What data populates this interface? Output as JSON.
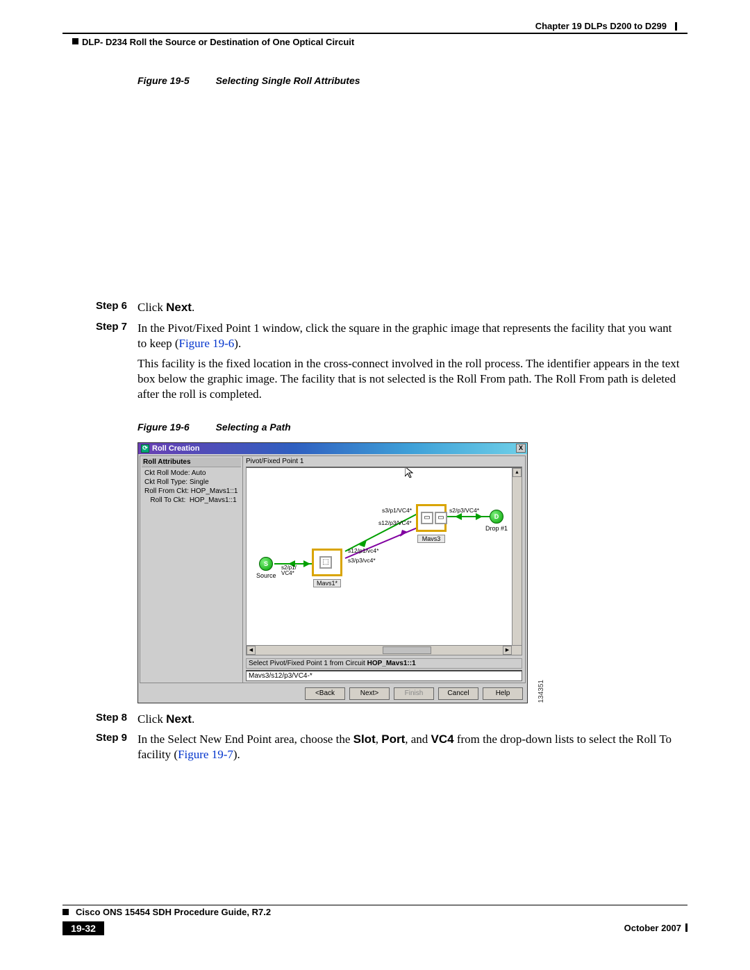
{
  "header": {
    "chapter": "Chapter 19  DLPs D200 to D299",
    "subtitle": "DLP- D234 Roll the Source or Destination of One Optical Circuit"
  },
  "fig5": {
    "num": "Figure 19-5",
    "caption": "Selecting Single Roll Attributes"
  },
  "steps": {
    "s6_label": "Step 6",
    "s6_a": "Click ",
    "s6_b": "Next",
    "s6_c": ".",
    "s7_label": "Step 7",
    "s7_a": "In the Pivot/Fixed Point 1 window, click the square in the graphic image that represents the facility that you want to keep (",
    "s7_link": "Figure 19-6",
    "s7_b": ").",
    "para1": "This facility is the fixed location in the cross-connect involved in the roll process. The identifier appears in the text box below the graphic image. The facility that is not selected is the Roll From path. The Roll From path is deleted after the roll is completed.",
    "s8_label": "Step 8",
    "s8_a": "Click ",
    "s8_b": "Next",
    "s8_c": ".",
    "s9_label": "Step 9",
    "s9_a": "In the Select New End Point area, choose the ",
    "s9_slot": "Slot",
    "s9_b": ", ",
    "s9_port": "Port",
    "s9_c": ", and ",
    "s9_vc4": "VC4",
    "s9_d": " from the drop-down lists to select the Roll To facility (",
    "s9_link": "Figure 19-7",
    "s9_e": ")."
  },
  "fig6": {
    "num": "Figure 19-6",
    "caption": "Selecting a Path",
    "id": "134351"
  },
  "rollwin": {
    "title": "Roll Creation",
    "close": "X",
    "left_title": "Roll Attributes",
    "attrs": {
      "a1": "Ckt Roll Mode: Auto",
      "a2": "Ckt Roll Type: Single",
      "a3": "Roll From Ckt:  HOP_Mavs1::1",
      "a4": "   Roll To Ckt:  HOP_Mavs1::1"
    },
    "graph_label": "Pivot/Fixed Point 1",
    "select_row_a": "Select Pivot/Fixed Point 1 from Circuit ",
    "select_row_b": "HOP_Mavs1::1",
    "input_value": "Mavs3/s12/p3/VC4-*",
    "nodes": {
      "source_label": "Source",
      "source_endpt": "S",
      "drop_label": "Drop #1",
      "drop_endpt": "D",
      "mavs1_label": "Mavs1*",
      "mavs3_label": "Mavs3",
      "s2p1": "s2/p1/\nVC4*",
      "s12p1": "s12/p1/vc4*",
      "s3p3": "s3/p3/vc4*",
      "s3p1": "s3/p1/VC4*",
      "s12p3": "s12/p3/VC4*",
      "s2p3": "s2/p3/VC4*"
    },
    "buttons": {
      "back": "<Back",
      "next": "Next>",
      "finish": "Finish",
      "cancel": "Cancel",
      "help": "Help"
    }
  },
  "footer": {
    "doc": "Cisco ONS 15454 SDH Procedure Guide, R7.2",
    "page": "19-32",
    "date": "October 2007"
  }
}
